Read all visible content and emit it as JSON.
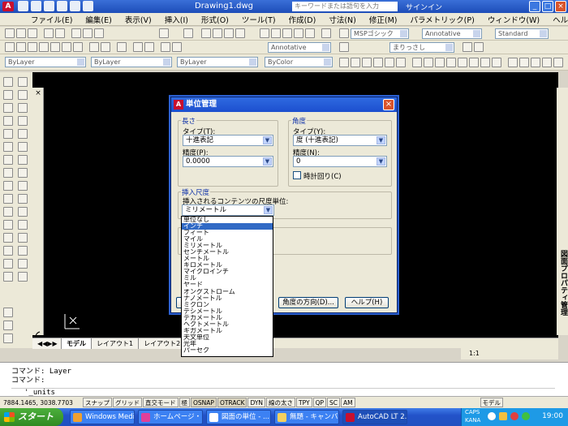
{
  "app": {
    "title": "Drawing1.dwg",
    "search_placeholder": "キーワードまたは語句を入力",
    "signin": "サインイン"
  },
  "menu": [
    "ファイル(E)",
    "編集(E)",
    "表示(V)",
    "挿入(I)",
    "形式(O)",
    "ツール(T)",
    "作成(D)",
    "寸法(N)",
    "修正(M)",
    "パラメトリック(P)",
    "ウィンドウ(W)",
    "ヘルプ(H)"
  ],
  "toolbars": {
    "font_style": "MSPゴシック",
    "annotative": "Annotative",
    "standard": "Standard",
    "layer": "ByLayer",
    "linetype": "ByLayer",
    "lineweight": "ByLayer",
    "color": "ByColor",
    "unnamed": "まりっさし"
  },
  "palette": {
    "left_label": "プロパティ",
    "right_label": "図面プロパティ管理"
  },
  "layout_tabs": [
    "モデル",
    "レイアウト1",
    "レイアウト2"
  ],
  "command": {
    "line1": "コマンド: Layer",
    "line2": "コマンド:",
    "prompt": "'_units"
  },
  "status": {
    "coords": "7884.1465, 3038.7703",
    "buttons": [
      "スナップ",
      "グリッド",
      "直交モード",
      "極",
      "OSNAP",
      "OTRACK",
      "DYN",
      "線の太さ",
      "TPY",
      "QP",
      "SC",
      "AM"
    ],
    "on_buttons": [
      "OSNAP",
      "OTRACK"
    ],
    "model": "モデル",
    "scale": "1:1"
  },
  "dialog": {
    "title": "単位管理",
    "length": {
      "group": "長さ",
      "type_label": "タイプ(T):",
      "type_value": "十進表記",
      "precision_label": "精度(P):",
      "precision_value": "0.0000"
    },
    "angle": {
      "group": "角度",
      "type_label": "タイプ(Y):",
      "type_value": "度 (十進表記)",
      "precision_label": "精度(N):",
      "precision_value": "0",
      "clockwise_label": "時計回り(C)"
    },
    "insertion": {
      "group": "挿入尺度",
      "label": "挿入されるコンテンツの尺度単位:",
      "value": "ミリメートル"
    },
    "buttons": {
      "direction": "角度の方向(D)...",
      "help": "ヘルプ(H)"
    }
  },
  "dropdown_options": [
    "単位なし",
    "インチ",
    "フィート",
    "マイル",
    "ミリメートル",
    "センチメートル",
    "メートル",
    "キロメートル",
    "マイクロインチ",
    "ミル",
    "ヤード",
    "オングストローム",
    "ナノメートル",
    "ミクロン",
    "デシメートル",
    "デカメートル",
    "ヘクトメートル",
    "ギガメートル",
    "天文単位",
    "光年",
    "パーセク"
  ],
  "dropdown_highlight_index": 1,
  "taskbar": {
    "start": "スタート",
    "tasks": [
      "Windows Medi...",
      "ホームページ・ビ...",
      "図面の単位 - ...",
      "無題 - キャンバ...",
      "AutoCAD LT 2..."
    ],
    "active_index": 4,
    "clock": "19:00",
    "caps": "CAPS",
    "kana": "KANA"
  }
}
